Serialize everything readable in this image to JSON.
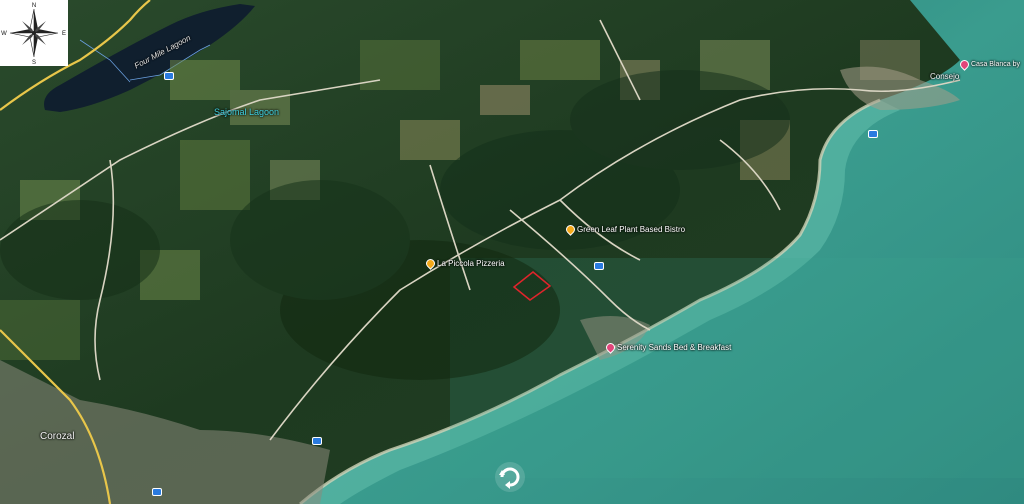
{
  "map": {
    "labels": {
      "four_mile_lagoon": "Four Mile Lagoon",
      "sajomal_lagoon": "Sajomal Lagoon",
      "consejo": "Consejo",
      "corozal": "Corozal"
    },
    "pois": {
      "green_leaf": "Green Leaf Plant Based Bistro",
      "la_piccola": "La Piccola Pizzeria",
      "serenity_sands": "Serenity Sands Bed & Breakfast",
      "casa_blanca": "Casa Blanca by"
    },
    "compass": {
      "n": "N",
      "s": "S",
      "e": "E",
      "w": "W"
    },
    "icons": {
      "compass": "compass-rose-icon",
      "rotate": "rotate-view-icon",
      "restaurant": "restaurant-pin-icon",
      "hotel": "hotel-pin-icon"
    },
    "colors": {
      "forest": "#1f3b20",
      "sea": "#2f8d82",
      "shallow": "#56b3a3",
      "boundary": "#e0242b",
      "road": "#d9d4c2",
      "water_label": "#3fd0e0"
    }
  }
}
